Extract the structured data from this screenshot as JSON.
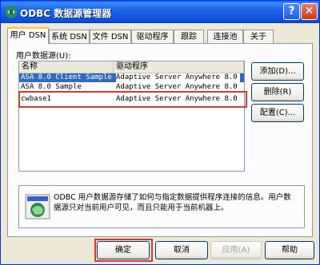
{
  "window": {
    "title": "ODBC 数据源管理器",
    "help_glyph": "?",
    "close_glyph": "✕"
  },
  "tabs": [
    {
      "label": "用户 DSN",
      "active": true
    },
    {
      "label": "系统 DSN",
      "active": false
    },
    {
      "label": "文件 DSN",
      "active": false
    },
    {
      "label": "驱动程序",
      "active": false
    },
    {
      "label": "跟踪",
      "active": false
    },
    {
      "label": "连接池",
      "active": false
    },
    {
      "label": "关于",
      "active": false
    }
  ],
  "section_label": "用户数据源(U):",
  "list": {
    "columns": [
      "名称",
      "驱动程序"
    ],
    "rows": [
      {
        "name": "ASA 8.0 Client Sample",
        "driver": "Adaptive Server Anywhere 8.0",
        "selected": true
      },
      {
        "name": "ASA 8.0 Sample",
        "driver": "Adaptive Server Anywhere 8.0",
        "selected": false
      },
      {
        "name": "cwbase1",
        "driver": "Adaptive Server Anywhere 8.0",
        "selected": false
      }
    ]
  },
  "side_buttons": {
    "add": "添加(D)...",
    "remove": "删除(R)",
    "configure": "配置(C)..."
  },
  "info_text": "ODBC 用户数据源存储了如何与指定数据提供程序连接的信息。用户数据源只对当前用户可见，而且只能用于当前机器上。",
  "bottom_buttons": {
    "ok": "确定",
    "cancel": "取消",
    "apply": "应用(A)",
    "help": "帮助"
  },
  "colors": {
    "highlight": "#E0382B",
    "selection": "#316AC5",
    "title_bar": "#0B4FD8"
  }
}
